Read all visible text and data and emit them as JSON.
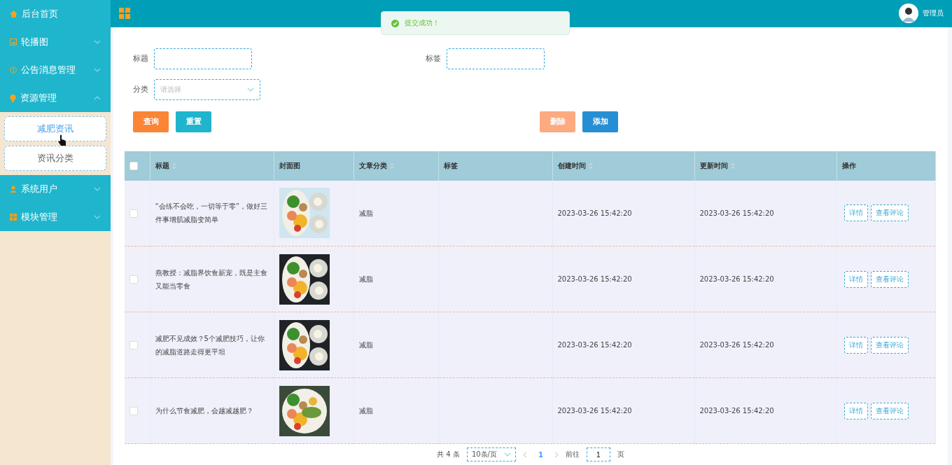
{
  "sidebar": {
    "items": [
      {
        "label": "后台首页",
        "kind": "link"
      },
      {
        "label": "轮播图",
        "kind": "group",
        "expanded": false
      },
      {
        "label": "公告消息管理",
        "kind": "group",
        "expanded": false
      },
      {
        "label": "资源管理",
        "kind": "group",
        "expanded": true,
        "children": [
          {
            "label": "减肥资讯",
            "selected": true
          },
          {
            "label": "资讯分类",
            "selected": false
          }
        ]
      },
      {
        "label": "系统用户",
        "kind": "group",
        "expanded": false
      },
      {
        "label": "模块管理",
        "kind": "group",
        "expanded": false
      }
    ]
  },
  "header": {
    "user": "管理员"
  },
  "toast": {
    "message": "提交成功！"
  },
  "filters": {
    "title_label": "标题",
    "tag_label": "标签",
    "category_label": "分类",
    "category_placeholder": "请选择"
  },
  "buttons": [
    {
      "label": "查询",
      "kind": "search",
      "disabled": false
    },
    {
      "label": "重置",
      "kind": "reset",
      "disabled": false
    },
    {
      "label": "删除",
      "kind": "delete",
      "disabled": true
    },
    {
      "label": "添加",
      "kind": "add",
      "disabled": false
    }
  ],
  "table": {
    "all_checked": false,
    "columns": [
      {
        "label": "标题",
        "sortable": true
      },
      {
        "label": "封面图",
        "sortable": false
      },
      {
        "label": "文章分类",
        "sortable": true
      },
      {
        "label": "标签",
        "sortable": false
      },
      {
        "label": "创建时间",
        "sortable": true
      },
      {
        "label": "更新时间",
        "sortable": true
      },
      {
        "label": "操作",
        "sortable": false
      }
    ],
    "rows": [
      {
        "checked": false,
        "title": "“会练不会吃，一切等于零”，做好三件事增肌减脂变简单",
        "category": "减脂",
        "created": "2023-03-26 15:42:20",
        "updated": "2023-03-26 15:42:20",
        "actions": [
          "详情",
          "查看评论"
        ]
      },
      {
        "checked": false,
        "title": "燕教授：减脂界饮食新宠，既是主食又能当零食",
        "category": "减脂",
        "created": "2023-03-26 15:42:20",
        "updated": "2023-03-26 15:42:20",
        "actions": [
          "详情",
          "查看评论"
        ]
      },
      {
        "checked": false,
        "title": "减肥不见成效？5个减肥技巧，让你的减脂道路走得更平坦",
        "category": "减脂",
        "created": "2023-03-26 15:42:20",
        "updated": "2023-03-26 15:42:20",
        "actions": [
          "详情",
          "查看评论"
        ]
      },
      {
        "checked": false,
        "title": "为什么节食减肥，会越减越肥？",
        "category": "减脂",
        "created": "2023-03-26 15:42:20",
        "updated": "2023-03-26 15:42:20",
        "actions": [
          "详情",
          "查看评论"
        ]
      }
    ]
  },
  "pagination": {
    "total": "共 4 条",
    "page_size": "10条/页",
    "pages": [
      {
        "label": "1",
        "selected": true
      }
    ],
    "goto_label": "前往",
    "goto_value": "1",
    "page_unit": "页"
  }
}
